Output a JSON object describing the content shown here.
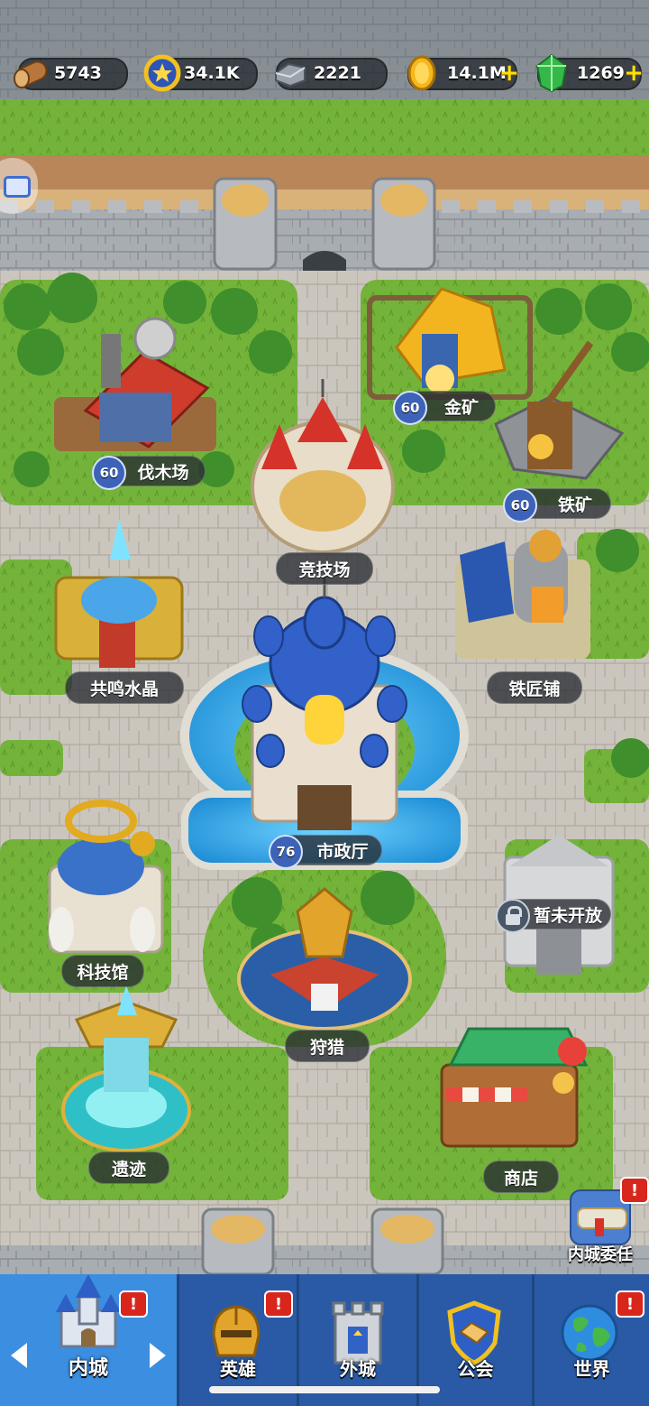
{
  "resources": [
    {
      "name": "wood-icon",
      "value": "5743"
    },
    {
      "name": "medal-icon",
      "value": "34.1K"
    },
    {
      "name": "iron-icon",
      "value": "2221"
    },
    {
      "name": "gold-icon",
      "value": "14.1M"
    },
    {
      "name": "gem-icon",
      "value": "1269"
    }
  ],
  "buildings": {
    "lumber": {
      "label": "伐木场",
      "level": "60"
    },
    "gold_mine": {
      "label": "金矿",
      "level": "60"
    },
    "iron_mine": {
      "label": "铁矿",
      "level": "60"
    },
    "arena": {
      "label": "竞技场"
    },
    "crystal": {
      "label": "共鸣水晶"
    },
    "smithy": {
      "label": "铁匠铺"
    },
    "townhall": {
      "label": "市政厅",
      "level": "76"
    },
    "tech": {
      "label": "科技馆"
    },
    "locked": {
      "label": "暂未开放"
    },
    "hunt": {
      "label": "狩猎"
    },
    "ruins": {
      "label": "遗迹"
    },
    "shop": {
      "label": "商店"
    },
    "commission": {
      "label": "内城委任"
    }
  },
  "nav": {
    "inner": "内城",
    "heroes": "英雄",
    "outer": "外城",
    "guild": "公会",
    "world": "世界"
  },
  "badge_mark": "!",
  "colors": {
    "nav_bg": "#2a5aa6",
    "nav_active": "#3b8ee0",
    "level_badge": "#3c63b8",
    "plus": "#ffe100"
  }
}
